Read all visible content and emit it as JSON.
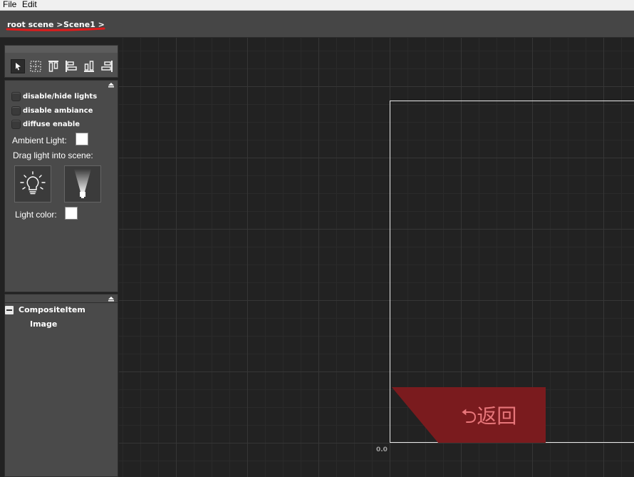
{
  "menu": {
    "file": "File",
    "edit": "Edit"
  },
  "breadcrumb": {
    "root": "root scene >",
    "scene": "Scene1 >"
  },
  "toolbar": {
    "tools": [
      "select-tool-icon",
      "marquee-tool-icon",
      "align-top-icon",
      "align-left-icon",
      "align-bottom-icon",
      "align-right-icon"
    ]
  },
  "lights": {
    "disable_hide_lights": "disable/hide lights",
    "disable_ambiance": "disable ambiance",
    "diffuse_enable": "diffuse enable",
    "ambient_light_label": "Ambient Light:",
    "drag_light_label": "Drag light into scene:",
    "light_color_label": "Light color:",
    "ambient_color": "#ffffff",
    "light_color": "#ffffff"
  },
  "tree": {
    "root_item": "CompositeItem",
    "child_item": "Image"
  },
  "canvas": {
    "back_label": "⮌返回",
    "origin_label": "0.0",
    "back_color": "#7a1b1e"
  }
}
